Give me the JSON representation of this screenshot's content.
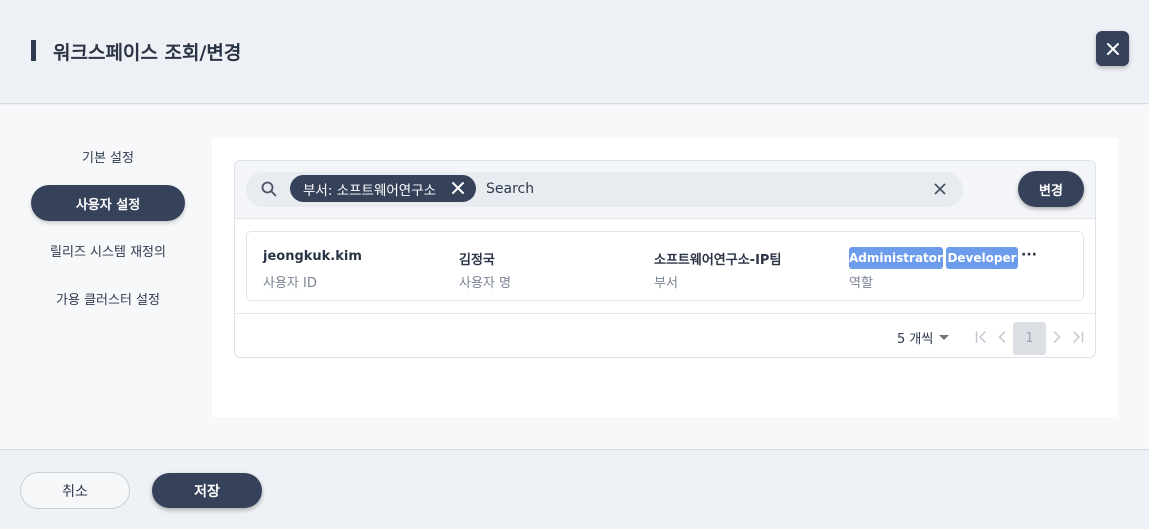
{
  "dialog": {
    "title": "워크스페이스 조회/변경"
  },
  "sidebar": {
    "items": [
      {
        "label": "기본 설정",
        "active": false
      },
      {
        "label": "사용자 설정",
        "active": true
      },
      {
        "label": "릴리즈 시스템 재정의",
        "active": false
      },
      {
        "label": "가용 클러스터 설정",
        "active": false
      }
    ]
  },
  "search": {
    "filter_chip": "부서: 소프트웨어연구소",
    "placeholder": "Search"
  },
  "actions": {
    "change_label": "변경"
  },
  "users": [
    {
      "user_id": "jeongkuk.kim",
      "user_id_label": "사용자 ID",
      "name": "김정국",
      "name_label": "사용자 명",
      "department": "소프트웨어연구소-IP팀",
      "department_label": "부서",
      "roles": [
        "Administrator",
        "Developer"
      ],
      "more": "···",
      "roles_label": "역할"
    }
  ],
  "pagination": {
    "page_size": "5 개씩",
    "current_page": "1"
  },
  "footer": {
    "cancel_label": "취소",
    "save_label": "저장"
  },
  "colors": {
    "primary": "#36415a",
    "role_badge": "#6d9cec"
  },
  "icons": [
    "close-icon",
    "search-icon",
    "chip-remove-icon",
    "clear-search-icon",
    "caret-down-icon",
    "first-page-icon",
    "prev-page-icon",
    "next-page-icon",
    "last-page-icon"
  ]
}
